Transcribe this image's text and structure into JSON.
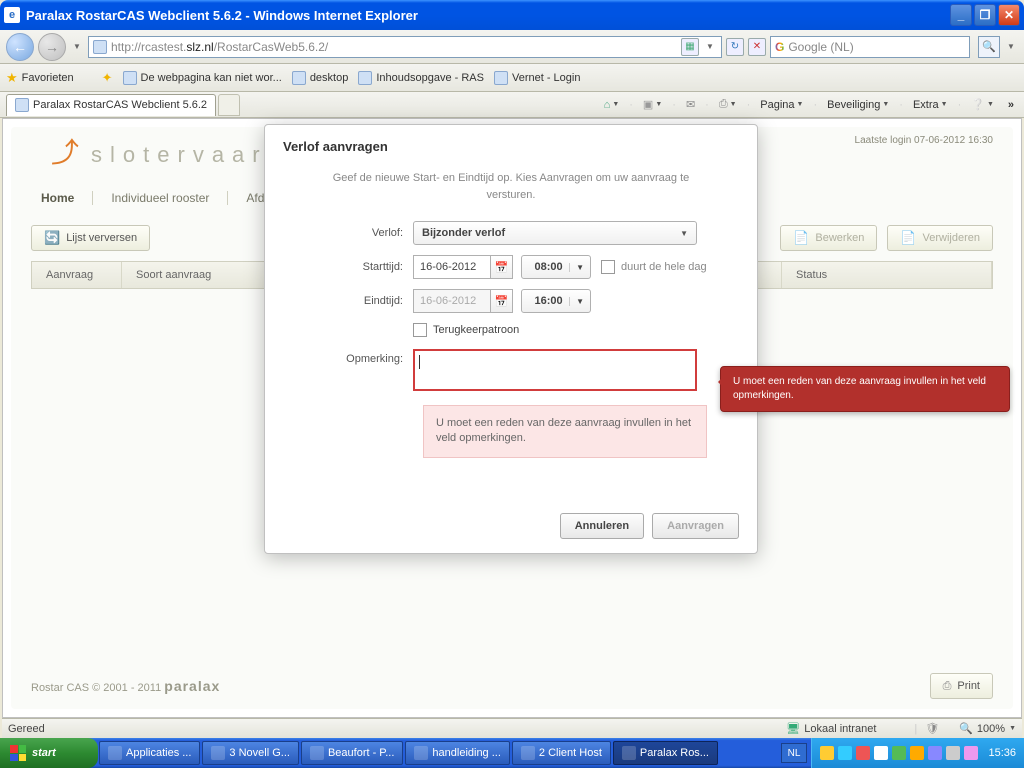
{
  "window": {
    "title": "Paralax RostarCAS Webclient 5.6.2 - Windows Internet Explorer"
  },
  "nav": {
    "url_grey_pre": "http://rcastest.",
    "url_dark": "slz.nl",
    "url_grey_post": "/RostarCasWeb5.6.2/",
    "search_placeholder": "Google (NL)"
  },
  "favrow": {
    "label": "Favorieten",
    "items": [
      "De webpagina kan niet wor...",
      "desktop",
      "Inhoudsopgave - RAS",
      "Vernet - Login"
    ]
  },
  "tabs": {
    "active": "Paralax RostarCAS Webclient 5.6.2"
  },
  "cmdbar": {
    "page": "Pagina",
    "security": "Beveiliging",
    "extra": "Extra"
  },
  "page": {
    "logo": "slotervaar",
    "login_info": "Laatste login 07-06-2012 16:30",
    "menu": [
      "Home",
      "Individueel rooster",
      "Afde"
    ],
    "toolbar": {
      "refresh": "Lijst verversen",
      "edit": "Bewerken",
      "delete": "Verwijderen"
    },
    "table_headers": {
      "aanvraag": "Aanvraag",
      "soort": "Soort aanvraag",
      "status": "Status"
    },
    "footer_copy": "Rostar CAS © 2001 - 2011",
    "footer_brand": "paralax",
    "print": "Print"
  },
  "dialog": {
    "title": "Verlof aanvragen",
    "intro": "Geef de nieuwe Start- en Eindtijd op. Kies Aanvragen om uw aanvraag te versturen.",
    "labels": {
      "verlof": "Verlof:",
      "starttijd": "Starttijd:",
      "eindtijd": "Eindtijd:",
      "opmerking": "Opmerking:"
    },
    "verlof_value": "Bijzonder verlof",
    "start_date": "16-06-2012",
    "start_time": "08:00",
    "end_date": "16-06-2012",
    "end_time": "16:00",
    "allday": "duurt de hele dag",
    "recurrence": "Terugkeerpatroon",
    "error": "U moet een reden van deze aanvraag invullen in het veld opmerkingen.",
    "buttons": {
      "cancel": "Annuleren",
      "submit": "Aanvragen"
    }
  },
  "callout": {
    "text": "U moet een reden van deze aanvraag invullen in het veld opmerkingen."
  },
  "iestatus": {
    "ready": "Gereed",
    "zone": "Lokaal intranet",
    "zoom": "100%"
  },
  "taskbar": {
    "start": "start",
    "items": [
      "Applicaties ...",
      "3 Novell G...",
      "Beaufort - P...",
      "handleiding ...",
      "2 Client Host",
      "Paralax Ros..."
    ],
    "lang": "NL",
    "clock": "15:36"
  }
}
